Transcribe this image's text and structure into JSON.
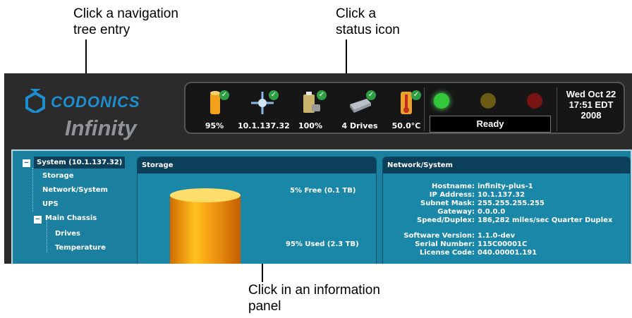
{
  "callouts": {
    "nav": [
      "Click a navigation",
      "tree entry"
    ],
    "status": [
      "Click a",
      "status icon"
    ],
    "panel": [
      "Click in an information",
      "panel"
    ]
  },
  "logo": {
    "top": "CODONICS",
    "bottom": "Infinity"
  },
  "status_icons": [
    {
      "name": "storage-status-icon",
      "value": "95%"
    },
    {
      "name": "network-status-icon",
      "value": "10.1.137.32"
    },
    {
      "name": "ups-status-icon",
      "value": "100%"
    },
    {
      "name": "drives-status-icon",
      "value": "4 Drives"
    },
    {
      "name": "temperature-status-icon",
      "value": "50.0°C"
    }
  ],
  "leds": {
    "green": "#31c83a",
    "amber": "#6b5a12",
    "red": "#7a1414"
  },
  "status_text": "Ready",
  "datetime": {
    "line1": "Wed Oct 22",
    "line2": "17:51 EDT",
    "line3": "2008"
  },
  "tree": {
    "root": "System (10.1.137.32)",
    "children": [
      "Storage",
      "Network/System",
      "UPS"
    ],
    "chassis": "Main Chassis",
    "chassis_children": [
      "Drives",
      "Temperature"
    ]
  },
  "storage_panel": {
    "title": "Storage",
    "free": "5% Free (0.1 TB)",
    "used": "95% Used (2.3 TB)",
    "used_fraction": 0.95
  },
  "network_panel": {
    "title": "Network/System",
    "rows": [
      {
        "k": "Hostname:",
        "v": "infinity-plus-1"
      },
      {
        "k": "IP Address:",
        "v": "10.1.137.32"
      },
      {
        "k": "Subnet Mask:",
        "v": "255.255.255.255"
      },
      {
        "k": "Gateway:",
        "v": "0.0.0.0"
      },
      {
        "k": "Speed/Duplex:",
        "v": "186,282 miles/sec Quarter Duplex"
      },
      {
        "k": "Software Version:",
        "v": "1.1.0-dev"
      },
      {
        "k": "Serial Number:",
        "v": "115C00001C"
      },
      {
        "k": "License Code:",
        "v": "040.00001.191"
      }
    ]
  }
}
